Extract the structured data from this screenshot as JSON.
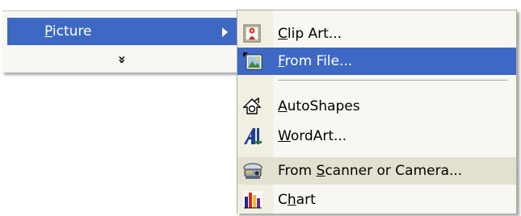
{
  "parent_menu": {
    "picture": {
      "label_accel": "P",
      "label_rest": "icture"
    },
    "expand_glyph": "»"
  },
  "submenu": {
    "clip_art": {
      "pre": "",
      "accel": "C",
      "post": "lip Art...",
      "icon": "clip-art-icon"
    },
    "from_file": {
      "pre": "",
      "accel": "F",
      "post": "rom File...",
      "icon": "from-file-icon"
    },
    "autoshapes": {
      "pre": "",
      "accel": "A",
      "post": "utoShapes",
      "icon": "autoshapes-icon"
    },
    "wordart": {
      "pre": "",
      "accel": "W",
      "post": "ordArt...",
      "icon": "wordart-icon"
    },
    "from_scanner": {
      "pre": "From ",
      "accel": "S",
      "post": "canner or Camera...",
      "icon": "scanner-camera-icon"
    },
    "chart": {
      "pre": "C",
      "accel": "h",
      "post": "art",
      "icon": "chart-icon"
    }
  },
  "colors": {
    "highlight": "#3d69c4",
    "hover": "#e4e0d0",
    "menu_bg": "#f8f7f1"
  }
}
